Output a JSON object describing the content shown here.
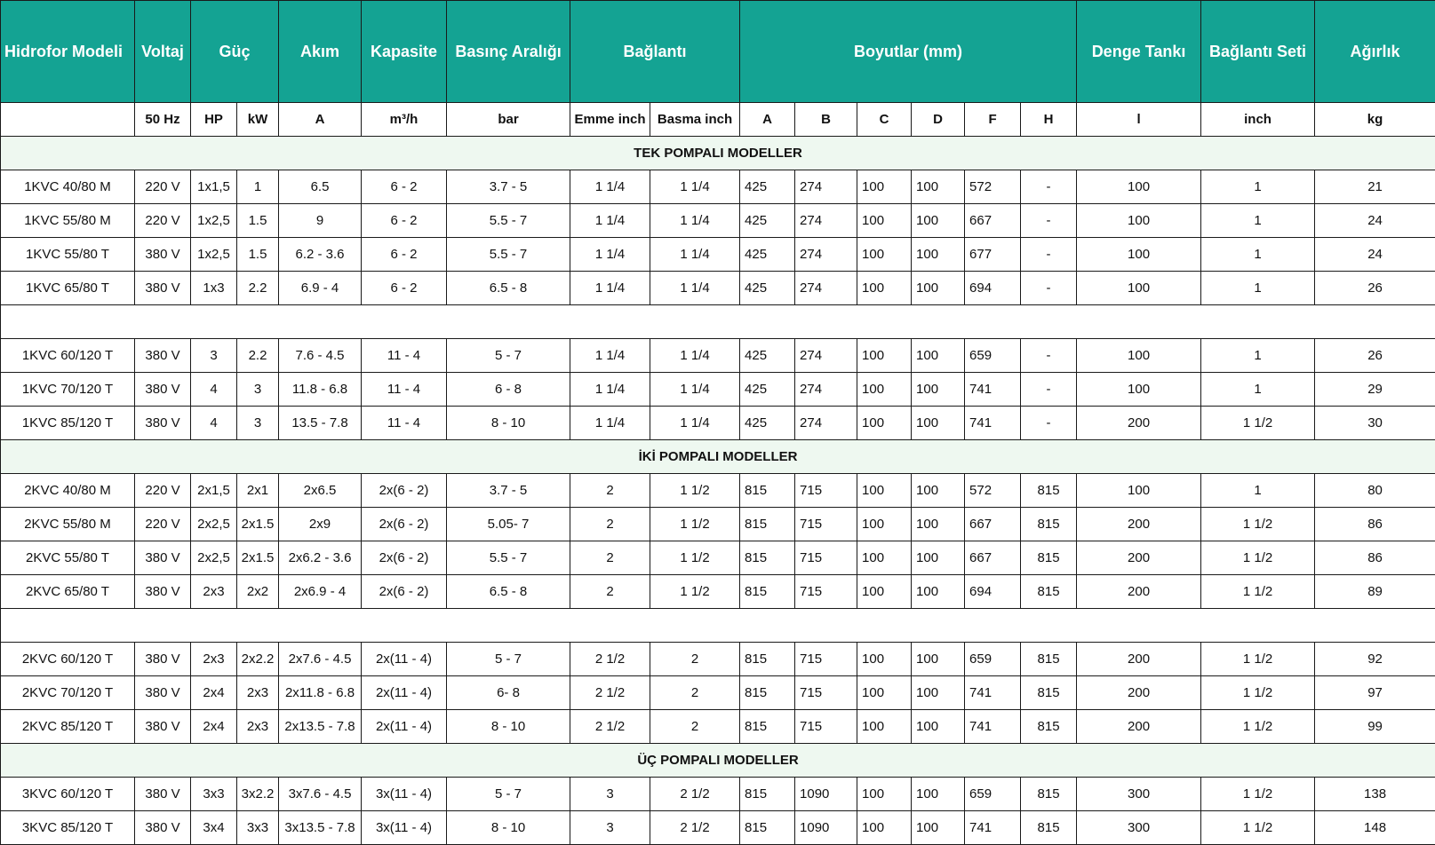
{
  "header": {
    "model": "Hidrofor Modeli",
    "voltage": "Voltaj",
    "power": "Güç",
    "current": "Akım",
    "capacity": "Kapasite",
    "pressure": "Basınç Aralığı",
    "connection": "Bağlantı",
    "dimensions": "Boyutlar (mm)",
    "tank": "Denge Tankı",
    "connection_set": "Bağlantı Seti",
    "weight": "Ağırlık"
  },
  "units": [
    "",
    "50 Hz",
    "HP",
    "kW",
    "A",
    "m³/h",
    "bar",
    "Emme inch",
    "Basma inch",
    "A",
    "B",
    "C",
    "D",
    "F",
    "H",
    "l",
    "inch",
    "kg"
  ],
  "sections": {
    "single": "TEK POMPALI MODELLER",
    "double": "İKİ POMPALI MODELLER",
    "triple": "ÜÇ POMPALI MODELLER"
  },
  "rows": [
    [
      "1KVC 40/80 M",
      "220 V",
      "1x1,5",
      "1",
      "6.5",
      "6 - 2",
      "3.7 - 5",
      "1 1/4",
      "1 1/4",
      "425",
      "274",
      "100",
      "100",
      "572",
      "-",
      "100",
      "1",
      "21"
    ],
    [
      "1KVC 55/80 M",
      "220 V",
      "1x2,5",
      "1.5",
      "9",
      "6 - 2",
      "5.5 - 7",
      "1 1/4",
      "1 1/4",
      "425",
      "274",
      "100",
      "100",
      "667",
      "-",
      "100",
      "1",
      "24"
    ],
    [
      "1KVC 55/80 T",
      "380 V",
      "1x2,5",
      "1.5",
      "6.2 - 3.6",
      "6 - 2",
      "5.5 - 7",
      "1 1/4",
      "1 1/4",
      "425",
      "274",
      "100",
      "100",
      "677",
      "-",
      "100",
      "1",
      "24"
    ],
    [
      "1KVC 65/80 T",
      "380 V",
      "1x3",
      "2.2",
      "6.9 - 4",
      "6 - 2",
      "6.5 - 8",
      "1 1/4",
      "1 1/4",
      "425",
      "274",
      "100",
      "100",
      "694",
      "-",
      "100",
      "1",
      "26"
    ],
    [
      "1KVC 60/120 T",
      "380 V",
      "3",
      "2.2",
      "7.6 - 4.5",
      "11 - 4",
      "5 - 7",
      "1 1/4",
      "1 1/4",
      "425",
      "274",
      "100",
      "100",
      "659",
      "-",
      "100",
      "1",
      "26"
    ],
    [
      "1KVC 70/120 T",
      "380 V",
      "4",
      "3",
      "11.8 - 6.8",
      "11 - 4",
      "6 - 8",
      "1 1/4",
      "1 1/4",
      "425",
      "274",
      "100",
      "100",
      "741",
      "-",
      "100",
      "1",
      "29"
    ],
    [
      "1KVC 85/120 T",
      "380 V",
      "4",
      "3",
      "13.5 - 7.8",
      "11 - 4",
      "8 - 10",
      "1 1/4",
      "1 1/4",
      "425",
      "274",
      "100",
      "100",
      "741",
      "-",
      "200",
      "1 1/2",
      "30"
    ],
    [
      "2KVC 40/80 M",
      "220 V",
      "2x1,5",
      "2x1",
      "2x6.5",
      "2x(6 - 2)",
      "3.7 - 5",
      "2",
      "1 1/2",
      "815",
      "715",
      "100",
      "100",
      "572",
      "815",
      "100",
      "1",
      "80"
    ],
    [
      "2KVC 55/80 M",
      "220 V",
      "2x2,5",
      "2x1.5",
      "2x9",
      "2x(6 - 2)",
      "5.05- 7",
      "2",
      "1 1/2",
      "815",
      "715",
      "100",
      "100",
      "667",
      "815",
      "200",
      "1 1/2",
      "86"
    ],
    [
      "2KVC 55/80 T",
      "380 V",
      "2x2,5",
      "2x1.5",
      "2x6.2 - 3.6",
      "2x(6 - 2)",
      "5.5 - 7",
      "2",
      "1 1/2",
      "815",
      "715",
      "100",
      "100",
      "667",
      "815",
      "200",
      "1 1/2",
      "86"
    ],
    [
      "2KVC 65/80 T",
      "380 V",
      "2x3",
      "2x2",
      "2x6.9 - 4",
      "2x(6 - 2)",
      "6.5 - 8",
      "2",
      "1 1/2",
      "815",
      "715",
      "100",
      "100",
      "694",
      "815",
      "200",
      "1 1/2",
      "89"
    ],
    [
      "2KVC 60/120 T",
      "380 V",
      "2x3",
      "2x2.2",
      "2x7.6 - 4.5",
      "2x(11 - 4)",
      "5 - 7",
      "2 1/2",
      "2",
      "815",
      "715",
      "100",
      "100",
      "659",
      "815",
      "200",
      "1 1/2",
      "92"
    ],
    [
      "2KVC 70/120 T",
      "380 V",
      "2x4",
      "2x3",
      "2x11.8 - 6.8",
      "2x(11 - 4)",
      "6- 8",
      "2 1/2",
      "2",
      "815",
      "715",
      "100",
      "100",
      "741",
      "815",
      "200",
      "1 1/2",
      "97"
    ],
    [
      "2KVC 85/120 T",
      "380 V",
      "2x4",
      "2x3",
      "2x13.5 - 7.8",
      "2x(11 - 4)",
      "8 - 10",
      "2 1/2",
      "2",
      "815",
      "715",
      "100",
      "100",
      "741",
      "815",
      "200",
      "1 1/2",
      "99"
    ],
    [
      "3KVC 60/120 T",
      "380 V",
      "3x3",
      "3x2.2",
      "3x7.6 - 4.5",
      "3x(11 - 4)",
      "5 - 7",
      "3",
      "2 1/2",
      "815",
      "1090",
      "100",
      "100",
      "659",
      "815",
      "300",
      "1 1/2",
      "138"
    ],
    [
      "3KVC 85/120 T",
      "380 V",
      "3x4",
      "3x3",
      "3x13.5 - 7.8",
      "3x(11 - 4)",
      "8 - 10",
      "3",
      "2 1/2",
      "815",
      "1090",
      "100",
      "100",
      "741",
      "815",
      "300",
      "1 1/2",
      "148"
    ]
  ]
}
